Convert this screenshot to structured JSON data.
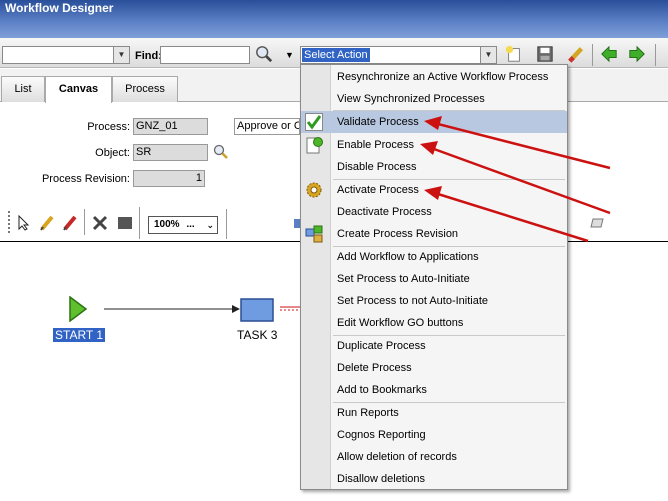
{
  "window": {
    "title": "Workflow Designer"
  },
  "toolbar": {
    "find_label": "Find:",
    "action_select_value": "Select Action",
    "icons": [
      "search-icon",
      "new-icon",
      "save-icon",
      "eraser-icon",
      "back-arrow-icon",
      "forward-arrow-icon"
    ]
  },
  "tabs": [
    {
      "label": "List",
      "active": false
    },
    {
      "label": "Canvas",
      "active": true
    },
    {
      "label": "Process",
      "active": false
    }
  ],
  "form": {
    "process_label": "Process:",
    "process_value": "GNZ_01",
    "description_value": "Approve or C",
    "object_label": "Object:",
    "object_value": "SR",
    "revision_label": "Process Revision:",
    "revision_value": "1"
  },
  "canvas_toolbar": {
    "zoom": "100%",
    "zoom_suffix": "..."
  },
  "canvas": {
    "nodes": [
      {
        "label": "START 1",
        "type": "start",
        "selected": true
      },
      {
        "label": "TASK 3",
        "type": "task",
        "selected": false
      }
    ]
  },
  "menu": {
    "groups": [
      [
        {
          "label": "Resynchronize an Active Workflow Process"
        },
        {
          "label": "View Synchronized Processes"
        }
      ],
      [
        {
          "label": "Validate Process",
          "highlighted": true,
          "icon": "checkmark-icon"
        },
        {
          "label": "Enable Process",
          "icon": "enable-process-icon"
        },
        {
          "label": "Disable Process"
        }
      ],
      [
        {
          "label": "Activate Process",
          "icon": "gear-icon"
        },
        {
          "label": "Deactivate Process"
        },
        {
          "label": "Create Process Revision",
          "icon": "revision-icon"
        }
      ],
      [
        {
          "label": "Add Workflow to Applications"
        },
        {
          "label": "Set Process to Auto-Initiate"
        },
        {
          "label": "Set Process to not Auto-Initiate"
        },
        {
          "label": "Edit Workflow GO buttons"
        }
      ],
      [
        {
          "label": "Duplicate Process"
        },
        {
          "label": "Delete Process"
        },
        {
          "label": "Add to Bookmarks"
        }
      ],
      [
        {
          "label": "Run Reports"
        },
        {
          "label": "Cognos Reporting"
        },
        {
          "label": "Allow deletion of records"
        },
        {
          "label": "Disallow deletions"
        }
      ]
    ]
  },
  "annotation_color": "#cc1111"
}
